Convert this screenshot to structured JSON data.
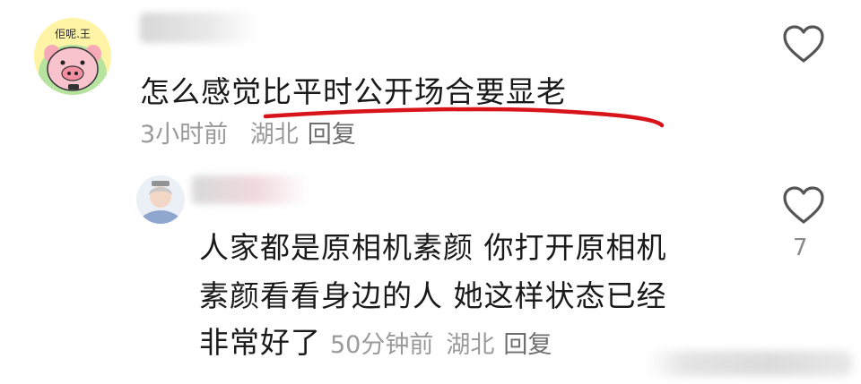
{
  "comments": [
    {
      "text": "怎么感觉比平时公开场合要显老",
      "time": "3小时前",
      "location": "湖北",
      "reply_label": "回复",
      "avatar": "pig-cartoon-avatar",
      "avatar_text": "佢呢.王",
      "like_icon": "heart-outline-icon"
    },
    {
      "lines": [
        "人家都是原相机素颜 你打开原相机",
        "素颜看看身边的人 她这样状态已经",
        "非常好了"
      ],
      "time": "50分钟前",
      "location": "湖北",
      "reply_label": "回复",
      "avatar": "person-photo-avatar",
      "like_icon": "heart-outline-icon",
      "like_count": "7"
    }
  ],
  "colors": {
    "text": "#1a1a1a",
    "meta": "#9a9a9a",
    "underline": "#d8141b"
  }
}
